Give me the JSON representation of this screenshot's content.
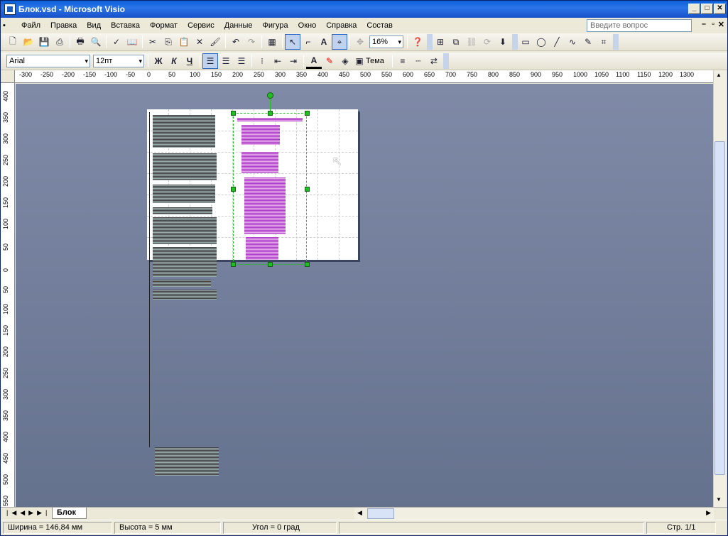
{
  "window": {
    "title": "Блок.vsd - Microsoft Visio"
  },
  "menu": [
    "Файл",
    "Правка",
    "Вид",
    "Вставка",
    "Формат",
    "Сервис",
    "Данные",
    "Фигура",
    "Окно",
    "Справка",
    "Состав"
  ],
  "help_placeholder": "Введите вопрос",
  "toolbar": {
    "zoom": "16%"
  },
  "format_toolbar": {
    "font": "Arial",
    "size": "12пт",
    "bold": "Ж",
    "italic": "К",
    "underline": "Ч",
    "theme": "Тема"
  },
  "ruler_h": [
    "-300",
    "-250",
    "-200",
    "-150",
    "-100",
    "-50",
    "0",
    "50",
    "100",
    "150",
    "200",
    "250",
    "300",
    "350",
    "400",
    "450",
    "500",
    "550",
    "600",
    "650",
    "700",
    "750",
    "800",
    "850",
    "900",
    "950",
    "1000",
    "1050",
    "1100",
    "1150",
    "1200",
    "1300"
  ],
  "ruler_v": [
    "400",
    "350",
    "300",
    "250",
    "200",
    "150",
    "100",
    "50",
    "0",
    "50",
    "100",
    "150",
    "200",
    "250",
    "300",
    "350",
    "400",
    "450",
    "500",
    "550"
  ],
  "page_tab": "Блок",
  "status": {
    "width": "Ширина = 146,84 мм",
    "height": "Высота = 5 мм",
    "angle": "Угол = 0 град",
    "page": "Стр. 1/1"
  },
  "colors": {
    "canvas_top": "#7f8aa7",
    "canvas_bottom": "#65728e",
    "selection": "#21c021",
    "pink": "#b040c8"
  }
}
